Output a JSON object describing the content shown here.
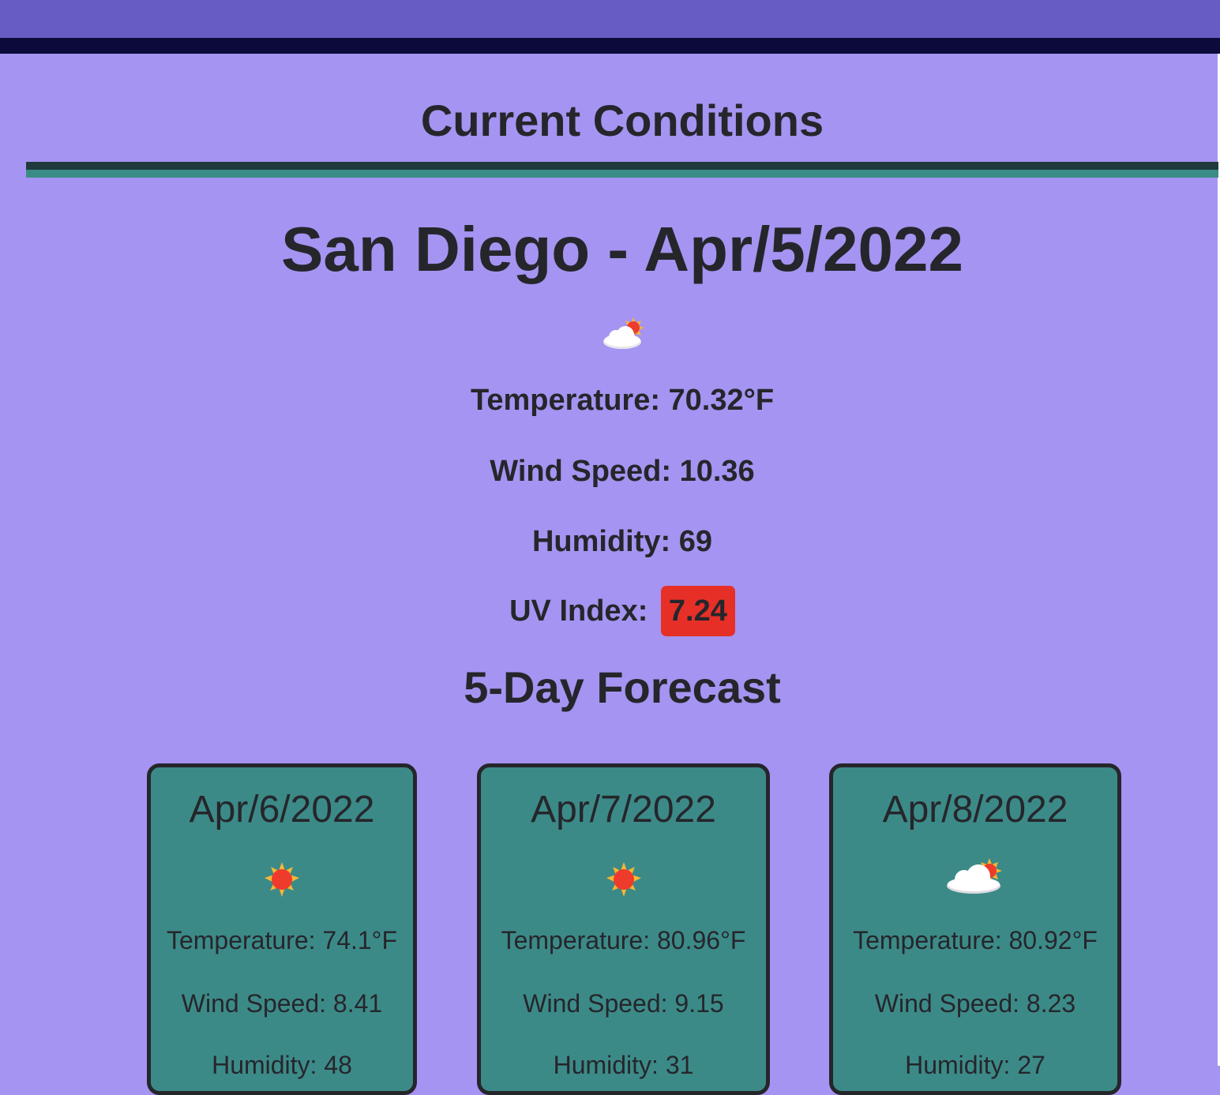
{
  "current": {
    "section_title": "Current Conditions",
    "city_date": "San Diego - Apr/5/2022",
    "icon": "partly-cloudy-icon",
    "temperature": "Temperature: 70.32°F",
    "wind": "Wind Speed: 10.36",
    "humidity": "Humidity: 69",
    "uv_label": "UV Index:",
    "uv_value": "7.24",
    "uv_color": "#e63027"
  },
  "forecast": {
    "title": "5-Day Forecast",
    "days": [
      {
        "date": "Apr/6/2022",
        "icon": "sun-icon",
        "temperature": "Temperature: 74.1°F",
        "wind": "Wind Speed: 8.41",
        "humidity": "Humidity: 48"
      },
      {
        "date": "Apr/7/2022",
        "icon": "sun-icon",
        "temperature": "Temperature: 80.96°F",
        "wind": "Wind Speed: 9.15",
        "humidity": "Humidity: 31"
      },
      {
        "date": "Apr/8/2022",
        "icon": "partly-cloudy-icon",
        "temperature": "Temperature: 80.92°F",
        "wind": "Wind Speed: 8.23",
        "humidity": "Humidity: 27"
      }
    ]
  },
  "colors": {
    "page_bg": "#a594f1",
    "header_bg": "#675cc4",
    "header_border": "#0b0a3a",
    "card_bg": "#3c8a88",
    "text": "#25262b"
  }
}
